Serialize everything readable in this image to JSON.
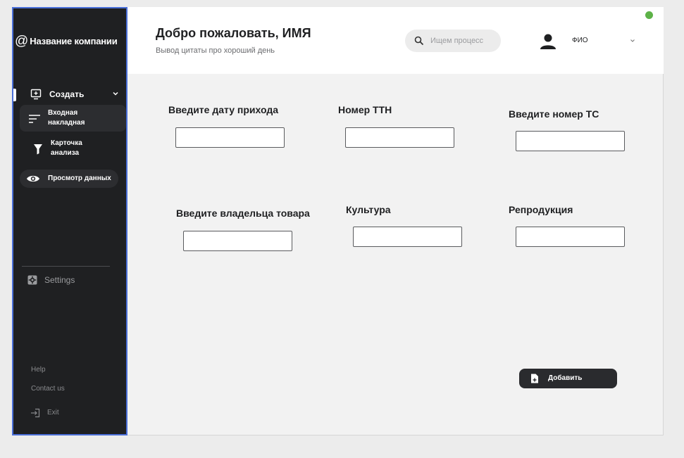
{
  "app": {
    "logo_mark": "@",
    "company_name": "Название компании"
  },
  "sidebar": {
    "create": {
      "label": "Создать",
      "icon": "add-screen-icon"
    },
    "items": [
      {
        "label_line1": "Входная",
        "label_line2": "накладная",
        "icon": "sort-lines-icon",
        "active": true
      },
      {
        "label_line1": "Карточка",
        "label_line2": "анализа",
        "icon": "filter-icon",
        "active": false
      }
    ],
    "view_data": {
      "label": "Просмотр данных",
      "icon": "eye-icon"
    },
    "settings": {
      "label": "Settings",
      "icon": "gear-icon"
    },
    "help": "Help",
    "contact": "Contact us",
    "exit": {
      "label": "Exit",
      "icon": "exit-icon"
    }
  },
  "header": {
    "greeting": "Добро пожаловать, ИМЯ",
    "quote": "Вывод цитаты про хороший день",
    "search": {
      "placeholder": "Ищем процесс",
      "value": ""
    },
    "user": {
      "name": "ФИО"
    }
  },
  "status": {
    "color": "#5db248"
  },
  "form": {
    "fields": [
      {
        "label": "Введите дату прихода",
        "value": ""
      },
      {
        "label": "Номер ТТН",
        "value": ""
      },
      {
        "label": "Введите номер ТС",
        "value": ""
      },
      {
        "label": "Введите владельца товара",
        "value": ""
      },
      {
        "label": "Культура",
        "value": ""
      },
      {
        "label": "Репродукция",
        "value": ""
      }
    ],
    "add_button": {
      "label": "Добавить",
      "icon": "add-file-icon"
    }
  },
  "colors": {
    "sidebar_bg": "#1f2022",
    "sidebar_border": "#4a6fd8",
    "accent_dark": "#2a2b2e"
  }
}
